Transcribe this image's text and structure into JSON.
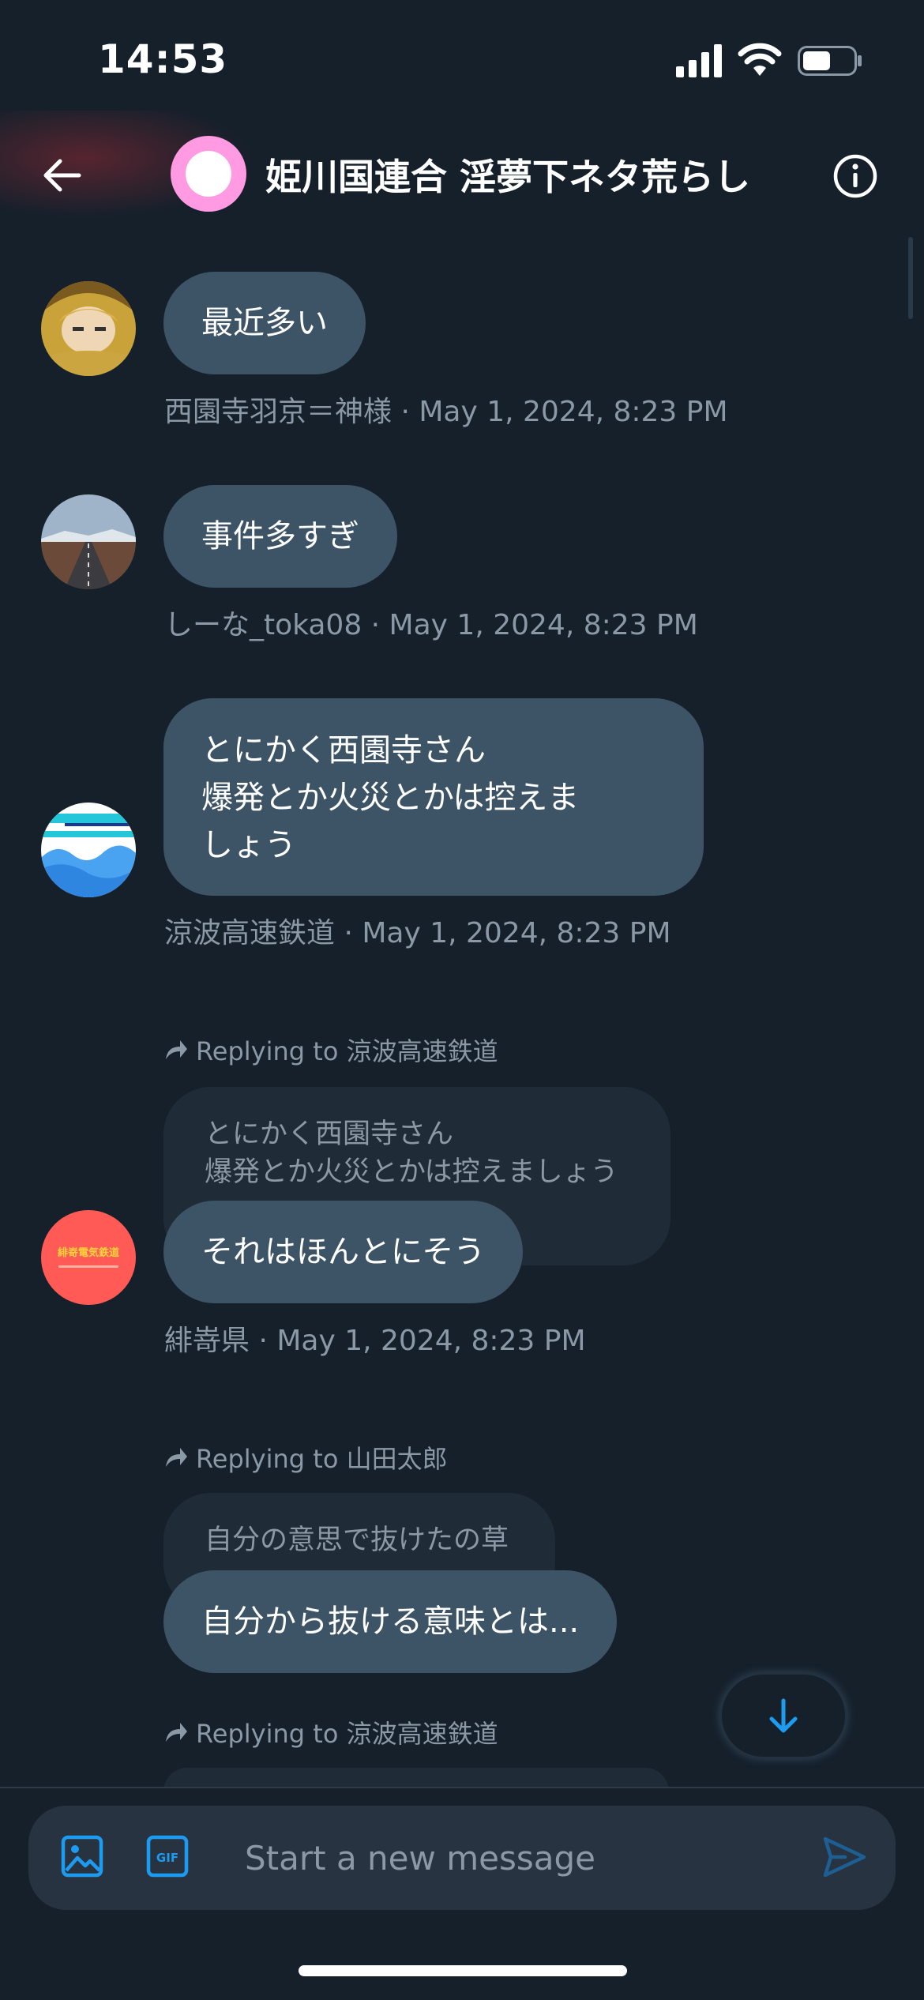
{
  "status_bar": {
    "time": "14:53"
  },
  "header": {
    "title": "姫川国連合 淫夢下ネタ荒らし"
  },
  "messages": [
    {
      "text": "最近多い",
      "meta": "西園寺羽京＝神様 · May 1, 2024, 8:23 PM"
    },
    {
      "text": "事件多すぎ",
      "meta": "しーな_toka08 · May 1, 2024, 8:23 PM"
    },
    {
      "text": "とにかく西園寺さん\n爆発とか火災とかは控えま\nしょう",
      "meta": "涼波高速鉄道 · May 1, 2024, 8:23 PM"
    },
    {
      "reply_to": "Replying to 涼波高速鉄道",
      "quote": "とにかく西園寺さん\n爆発とか火災とかは控えましょう",
      "text": "それはほんとにそう",
      "meta": "緋嵜県 · May 1, 2024, 8:23 PM"
    },
    {
      "reply_to": "Replying to 山田太郎",
      "quote": "自分の意思で抜けたの草",
      "text": "自分から抜ける意味とは..."
    },
    {
      "reply_to": "Replying to 涼波高速鉄道"
    }
  ],
  "avatars": {
    "hikazaki_logo_text": "緋嵜電気鉄道"
  },
  "composer": {
    "placeholder": "Start a new message",
    "gif_label": "GIF"
  },
  "colors": {
    "background": "#15202b",
    "bubble": "#3d5466",
    "accent": "#1d9bf0",
    "meta": "#8b98a5"
  }
}
